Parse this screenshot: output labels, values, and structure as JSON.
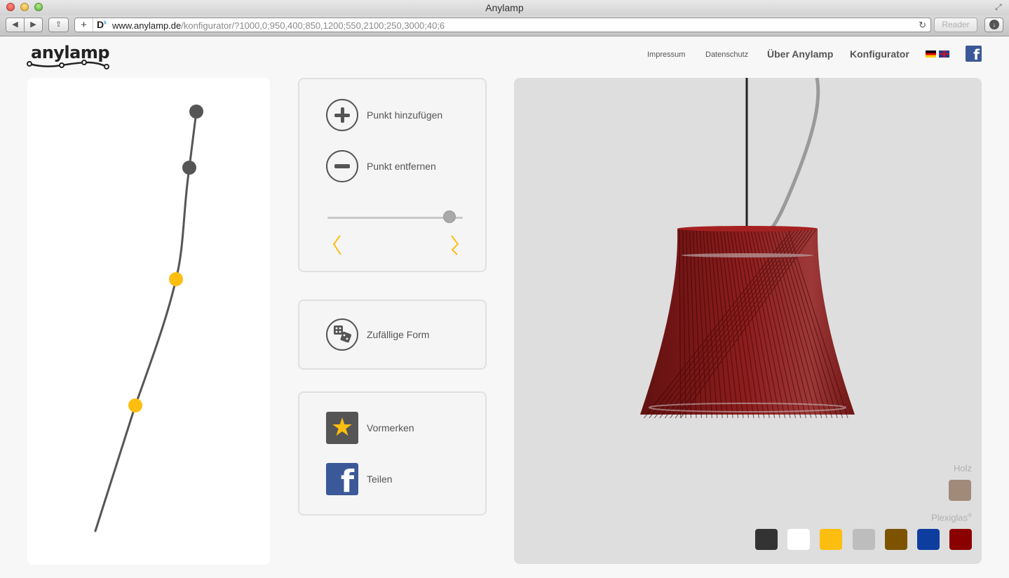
{
  "browser": {
    "window_title": "Anylamp",
    "url_host": "www.anylamp.de",
    "url_path": "/konfigurator/?1000,0;950,400;850,1200;550,2100;250,3000;40;6",
    "reader_label": "Reader",
    "favicon_text": "D"
  },
  "header": {
    "logo_text": "anylamp",
    "nav": {
      "impressum": "Impressum",
      "datenschutz": "Datenschutz",
      "ueber": "Über Anylamp",
      "konfigurator": "Konfigurator"
    },
    "languages": [
      "de",
      "en"
    ],
    "facebook_glyph": "f"
  },
  "controls": {
    "add_point": "Punkt hinzufügen",
    "remove_point": "Punkt entfernen",
    "slider_value": 0.9,
    "random_shape": "Zufällige Form",
    "bookmark": "Vormerken",
    "share": "Teilen"
  },
  "viewer": {
    "materials_wood_label": "Holz",
    "materials_plexi_label": "Plexiglas",
    "wood_colors": [
      "#a08a7a"
    ],
    "plexi_colors": [
      "#333333",
      "#ffffff",
      "#fdbe10",
      "#bdbdbd",
      "#7d5300",
      "#0e3da0",
      "#8b0000"
    ],
    "lamp_color": "#7a0c0c"
  },
  "colors": {
    "control_point": "#555555",
    "handle_point": "#fdbe10",
    "zigzag": "#fdbe10"
  },
  "icons": [
    "plus-icon",
    "minus-icon",
    "dice-icon",
    "star-icon",
    "facebook-icon",
    "reload-icon",
    "download-icon",
    "share-icon"
  ]
}
